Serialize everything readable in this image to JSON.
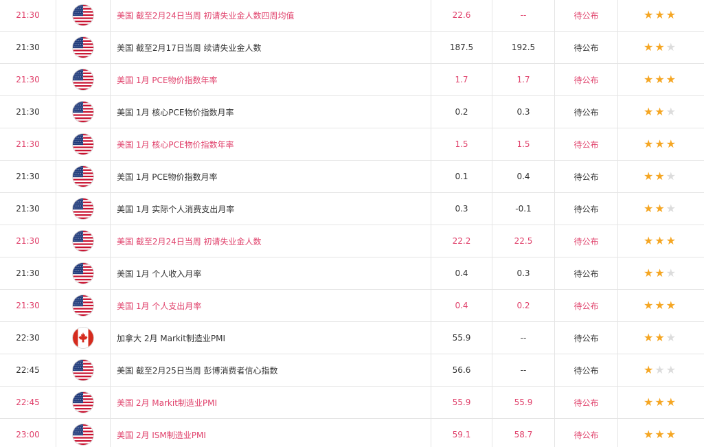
{
  "colors": {
    "highlight_text": "#e0416b",
    "normal_text": "#333333",
    "star_on": "#f5a623",
    "star_off": "#dcdcdc",
    "grid_line": "#e5e5e5"
  },
  "events": [
    {
      "time": "21:30",
      "country": "us",
      "flag_icon": "us-flag-icon",
      "event": "美国 截至2月24日当周 初请失业金人数四周均值",
      "previous": "22.6",
      "forecast": "--",
      "actual": "待公布",
      "importance": 3,
      "highlight": true
    },
    {
      "time": "21:30",
      "country": "us",
      "flag_icon": "us-flag-icon",
      "event": "美国 截至2月17日当周 续请失业金人数",
      "previous": "187.5",
      "forecast": "192.5",
      "actual": "待公布",
      "importance": 2,
      "highlight": false
    },
    {
      "time": "21:30",
      "country": "us",
      "flag_icon": "us-flag-icon",
      "event": "美国 1月 PCE物价指数年率",
      "previous": "1.7",
      "forecast": "1.7",
      "actual": "待公布",
      "importance": 3,
      "highlight": true
    },
    {
      "time": "21:30",
      "country": "us",
      "flag_icon": "us-flag-icon",
      "event": "美国 1月 核心PCE物价指数月率",
      "previous": "0.2",
      "forecast": "0.3",
      "actual": "待公布",
      "importance": 2,
      "highlight": false
    },
    {
      "time": "21:30",
      "country": "us",
      "flag_icon": "us-flag-icon",
      "event": "美国 1月 核心PCE物价指数年率",
      "previous": "1.5",
      "forecast": "1.5",
      "actual": "待公布",
      "importance": 3,
      "highlight": true
    },
    {
      "time": "21:30",
      "country": "us",
      "flag_icon": "us-flag-icon",
      "event": "美国 1月 PCE物价指数月率",
      "previous": "0.1",
      "forecast": "0.4",
      "actual": "待公布",
      "importance": 2,
      "highlight": false
    },
    {
      "time": "21:30",
      "country": "us",
      "flag_icon": "us-flag-icon",
      "event": "美国 1月 实际个人消费支出月率",
      "previous": "0.3",
      "forecast": "-0.1",
      "actual": "待公布",
      "importance": 2,
      "highlight": false
    },
    {
      "time": "21:30",
      "country": "us",
      "flag_icon": "us-flag-icon",
      "event": "美国 截至2月24日当周 初请失业金人数",
      "previous": "22.2",
      "forecast": "22.5",
      "actual": "待公布",
      "importance": 3,
      "highlight": true
    },
    {
      "time": "21:30",
      "country": "us",
      "flag_icon": "us-flag-icon",
      "event": "美国 1月 个人收入月率",
      "previous": "0.4",
      "forecast": "0.3",
      "actual": "待公布",
      "importance": 2,
      "highlight": false
    },
    {
      "time": "21:30",
      "country": "us",
      "flag_icon": "us-flag-icon",
      "event": "美国 1月 个人支出月率",
      "previous": "0.4",
      "forecast": "0.2",
      "actual": "待公布",
      "importance": 3,
      "highlight": true
    },
    {
      "time": "22:30",
      "country": "ca",
      "flag_icon": "canada-flag-icon",
      "event": "加拿大 2月 Markit制造业PMI",
      "previous": "55.9",
      "forecast": "--",
      "actual": "待公布",
      "importance": 2,
      "highlight": false
    },
    {
      "time": "22:45",
      "country": "us",
      "flag_icon": "us-flag-icon",
      "event": "美国 截至2月25日当周 彭博消费者信心指数",
      "previous": "56.6",
      "forecast": "--",
      "actual": "待公布",
      "importance": 1,
      "highlight": false
    },
    {
      "time": "22:45",
      "country": "us",
      "flag_icon": "us-flag-icon",
      "event": "美国 2月 Markit制造业PMI",
      "previous": "55.9",
      "forecast": "55.9",
      "actual": "待公布",
      "importance": 3,
      "highlight": true
    },
    {
      "time": "23:00",
      "country": "us",
      "flag_icon": "us-flag-icon",
      "event": "美国 2月 ISM制造业PMI",
      "previous": "59.1",
      "forecast": "58.7",
      "actual": "待公布",
      "importance": 3,
      "highlight": true
    }
  ]
}
